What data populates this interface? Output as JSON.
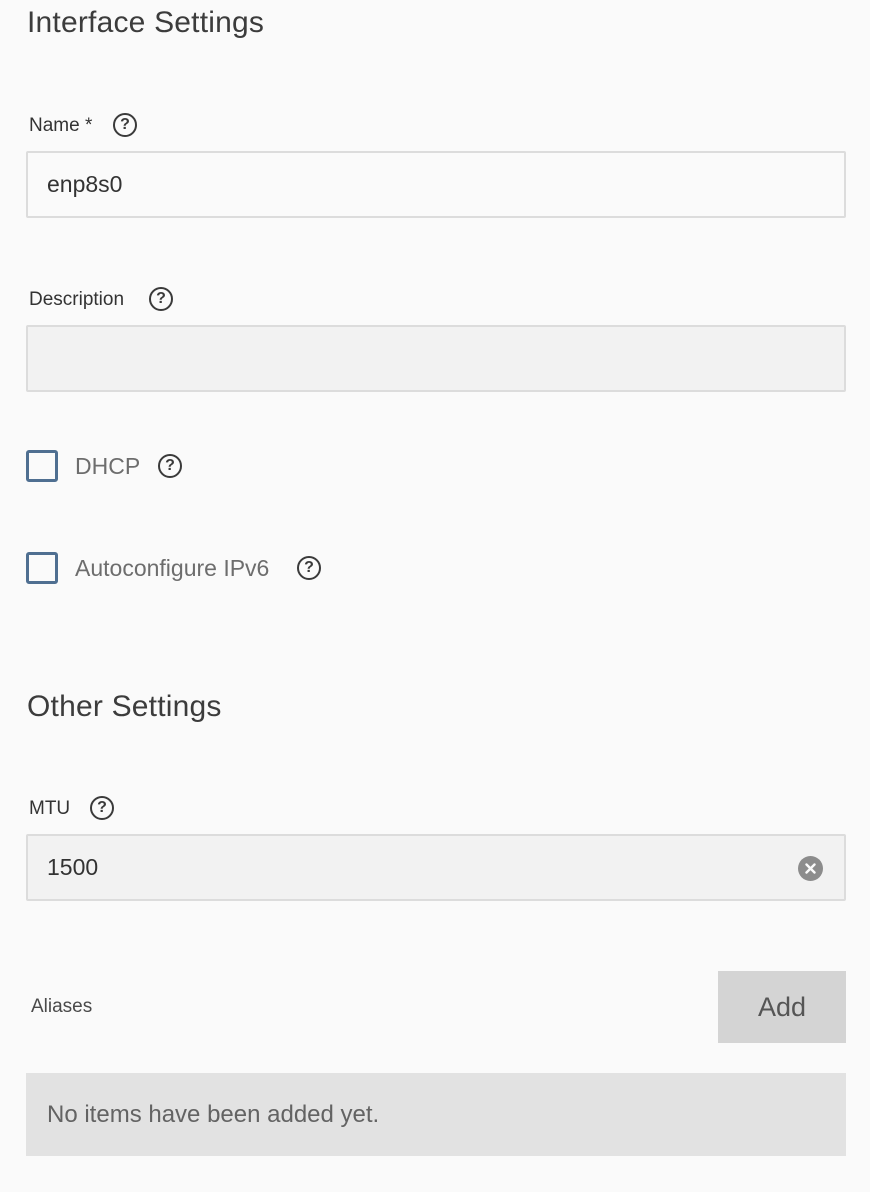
{
  "interface_settings": {
    "title": "Interface Settings",
    "name_label": "Name",
    "required_marker": "*",
    "name_value": "enp8s0",
    "description_label": "Description",
    "description_value": "",
    "dhcp_label": "DHCP",
    "dhcp_checked": false,
    "autoconfigure_ipv6_label": "Autoconfigure IPv6",
    "autoconfigure_ipv6_checked": false
  },
  "other_settings": {
    "title": "Other Settings",
    "mtu_label": "MTU",
    "mtu_value": "1500",
    "aliases_label": "Aliases",
    "add_button_label": "Add",
    "empty_message": "No items have been added yet."
  },
  "icons": {
    "help": "help-circle-icon",
    "clear": "clear-circle-icon",
    "help_glyph": "?"
  },
  "colors": {
    "background": "#fafafa",
    "checkbox_border": "#4f6f91",
    "add_button_bg": "#d4d4d4",
    "empty_box_bg": "#e2e2e2",
    "clear_icon": "#8c8c8c"
  }
}
